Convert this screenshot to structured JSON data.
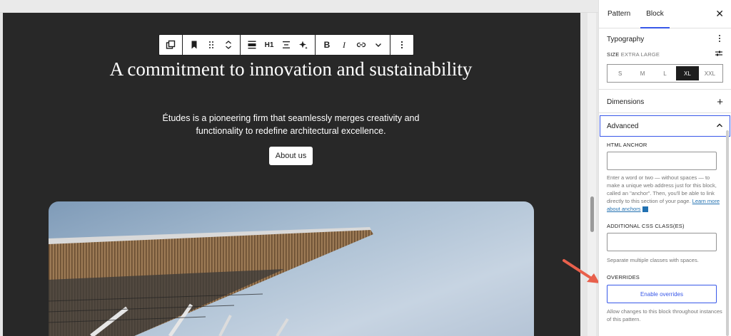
{
  "toolbar": {
    "heading_level": "H1"
  },
  "hero": {
    "headline": "A commitment to innovation and sustainability",
    "subtext": "Études is a pioneering firm that seamlessly merges creativity and functionality to redefine architectural excellence.",
    "button_label": "About us"
  },
  "sidebar": {
    "tabs": [
      {
        "label": "Pattern"
      },
      {
        "label": "Block"
      }
    ],
    "close_glyph": "✕",
    "typography": {
      "title": "Typography",
      "size_label": "SIZE",
      "size_value": "EXTRA LARGE",
      "options": [
        "S",
        "M",
        "L",
        "XL",
        "XXL"
      ],
      "selected": "XL"
    },
    "dimensions": {
      "title": "Dimensions",
      "glyph": "+"
    },
    "advanced": {
      "title": "Advanced",
      "html_anchor_label": "HTML ANCHOR",
      "html_anchor_value": "",
      "anchor_help": "Enter a word or two — without spaces — to make a unique web address just for this block, called an \"anchor\". Then, you'll be able to link directly to this section of your page.",
      "anchor_link": "Learn more about anchors",
      "css_label": "ADDITIONAL CSS CLASS(ES)",
      "css_value": "",
      "css_help": "Separate multiple classes with spaces.",
      "overrides_label": "OVERRIDES",
      "enable_overrides": "Enable overrides",
      "overrides_help": "Allow changes to this block throughout instances of this pattern."
    }
  },
  "colors": {
    "accent": "#3858e9",
    "dark_bg": "#282828",
    "arrow": "#e8604c"
  }
}
